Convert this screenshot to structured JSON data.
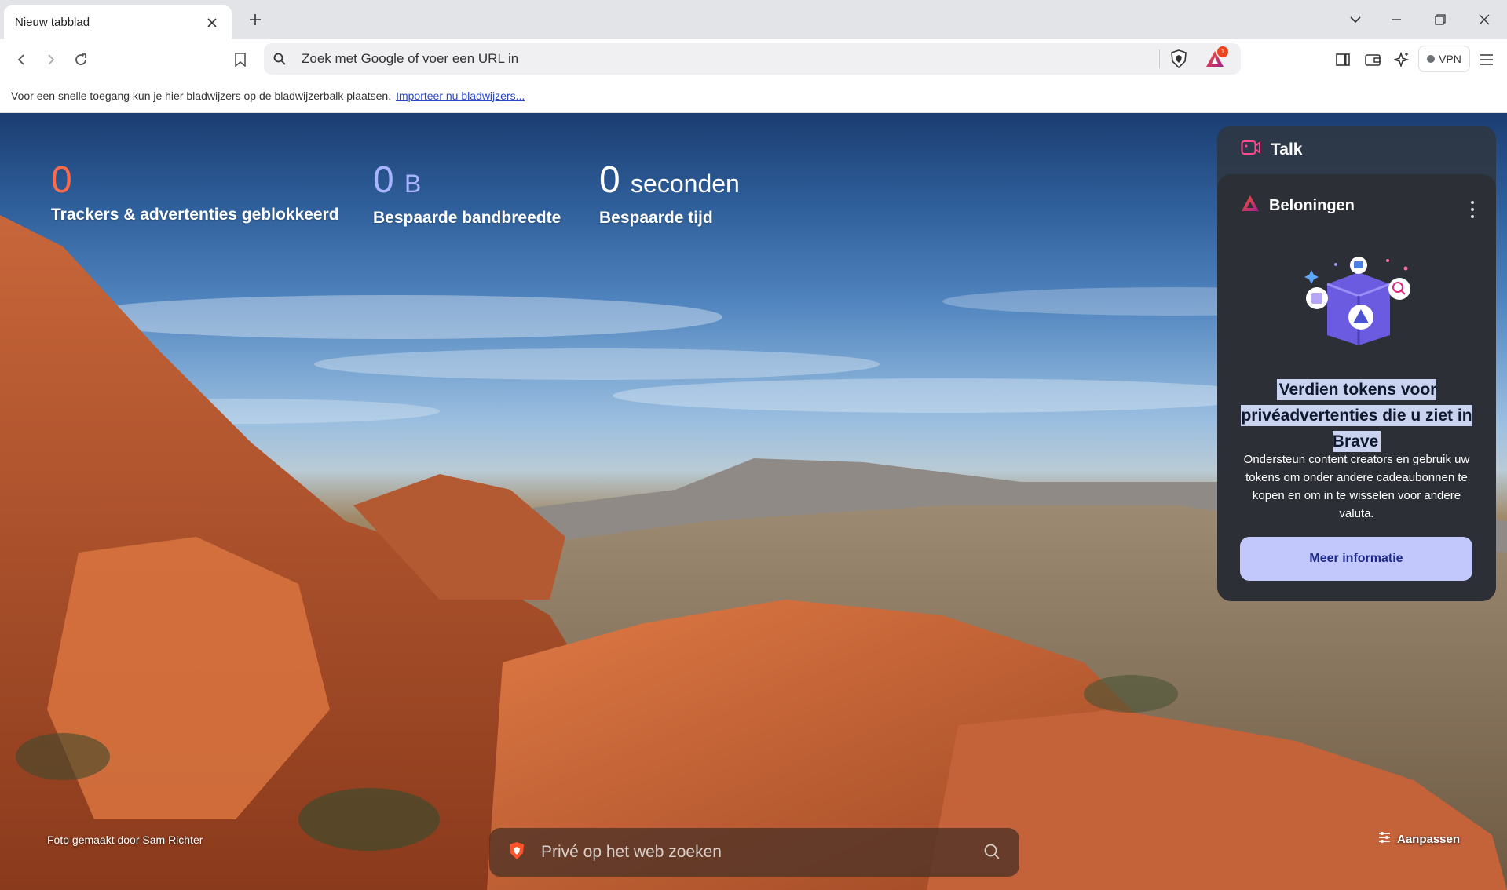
{
  "tab": {
    "title": "Nieuw tabblad"
  },
  "omnibox": {
    "placeholder": "Zoek met Google of voer een URL in"
  },
  "rewards_badge": "1",
  "vpn": {
    "label": "VPN"
  },
  "bookmarks_bar": {
    "message": "Voor een snelle toegang kun je hier bladwijzers op de bladwijzerbalk plaatsen.",
    "link": "Importeer nu bladwijzers..."
  },
  "stats": [
    {
      "value": "0",
      "unit": "",
      "label": "Trackers & advertenties geblokkeerd",
      "color": "#ff6b48"
    },
    {
      "value": "0",
      "unit": "B",
      "label": "Bespaarde bandbreedte",
      "color": "#a8b4ff"
    },
    {
      "value": "0",
      "unit": "seconden",
      "label": "Bespaarde tijd",
      "color": "#ffffff"
    }
  ],
  "widget": {
    "talk_label": "Talk",
    "rewards": {
      "title": "Beloningen",
      "headline": "Verdien tokens voor privéadvertenties die u ziet in Brave",
      "description": "Ondersteun content creators en gebruik uw tokens om onder andere cadeaubonnen te kopen en om in te wisselen voor andere valuta.",
      "button": "Meer informatie"
    }
  },
  "photo_credit": "Foto gemaakt door Sam Richter",
  "customize_label": "Aanpassen",
  "search": {
    "placeholder": "Privé op het web zoeken"
  },
  "colors": {
    "accent_orange": "#fb542b",
    "brave_purple": "#4c54d2",
    "button_bg": "#c2c8fb"
  },
  "icons": [
    "close-icon",
    "plus-icon",
    "chevron-down-icon",
    "minimize-icon",
    "restore-icon",
    "window-close-icon",
    "back-icon",
    "forward-icon",
    "reload-icon",
    "bookmark-icon",
    "search-icon",
    "brave-shield-icon",
    "rewards-triangle-icon",
    "sidebar-icon",
    "wallet-icon",
    "leo-ai-icon",
    "vpn-icon",
    "menu-icon",
    "talk-camera-icon",
    "more-vertical-icon",
    "customize-icon"
  ]
}
